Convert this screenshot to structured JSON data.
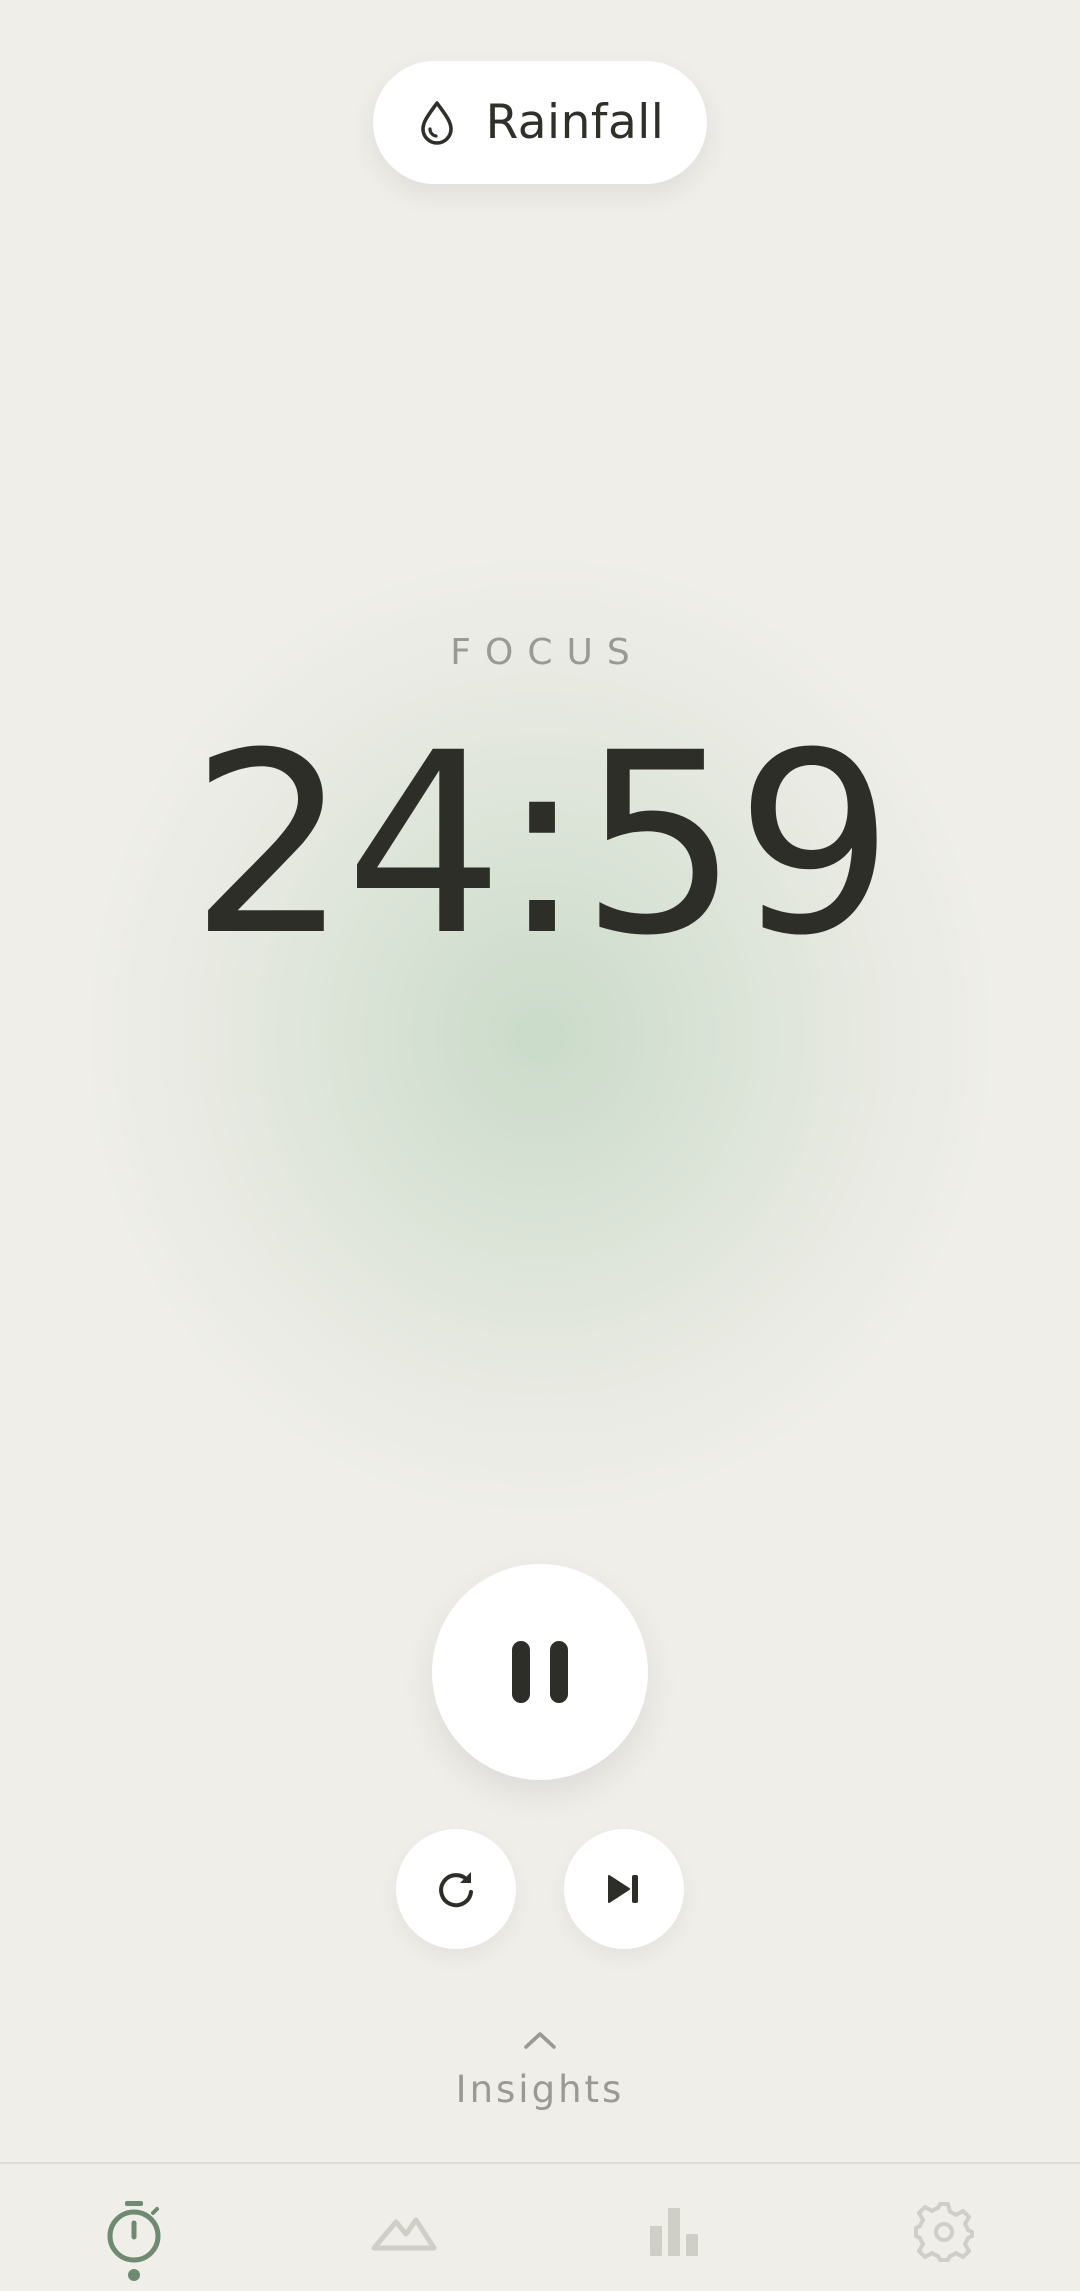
{
  "sound": {
    "label": "Rainfall",
    "icon": "water-drop-icon"
  },
  "timer": {
    "mode": "FOCUS",
    "time": "24:59"
  },
  "controls": {
    "primary": {
      "icon": "pause-icon",
      "state": "running"
    },
    "reset": {
      "icon": "restart-icon"
    },
    "skip": {
      "icon": "skip-next-icon"
    }
  },
  "insights": {
    "label": "Insights",
    "icon": "chevron-up-icon"
  },
  "bottom_nav": {
    "items": [
      {
        "id": "timer",
        "icon": "stopwatch-icon",
        "active": true
      },
      {
        "id": "landscape",
        "icon": "mountains-icon",
        "active": false
      },
      {
        "id": "stats",
        "icon": "bar-chart-icon",
        "active": false
      },
      {
        "id": "settings",
        "icon": "gear-icon",
        "active": false
      }
    ]
  },
  "colors": {
    "background": "#efeee9",
    "accent": "#6e8a72",
    "text_primary": "#2d2e28",
    "text_muted": "#9a9a92",
    "nav_inactive": "#cfcec7",
    "surface": "#ffffff"
  }
}
